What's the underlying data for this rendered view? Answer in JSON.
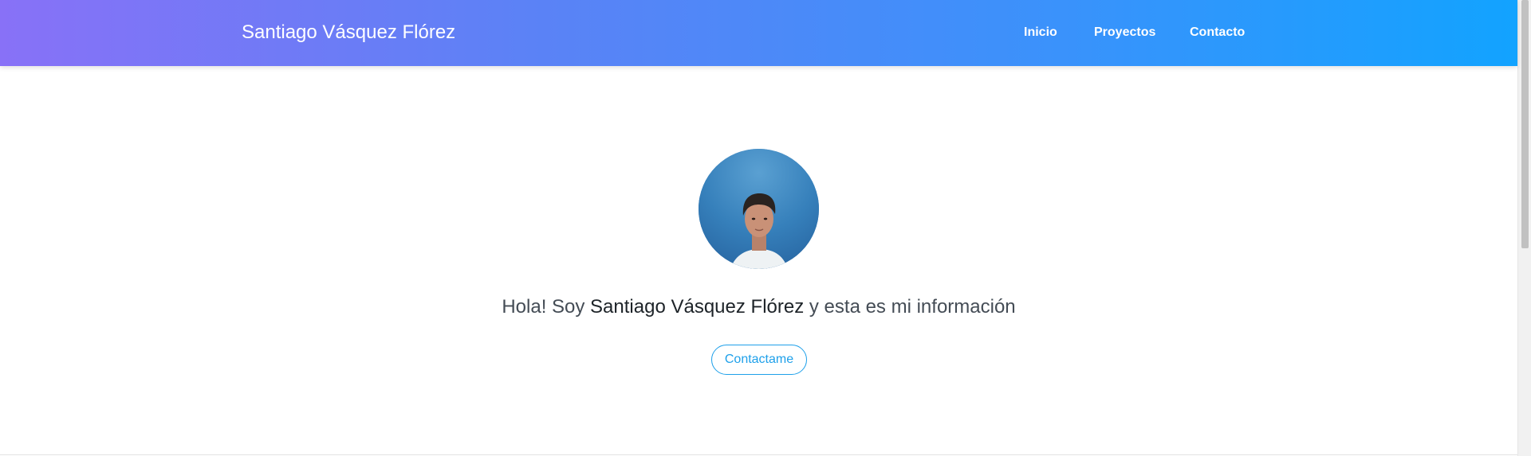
{
  "header": {
    "brand": "Santiago Vásquez Flórez",
    "nav": {
      "inicio": "Inicio",
      "proyectos": "Proyectos",
      "contacto": "Contacto"
    }
  },
  "hero": {
    "greeting_prefix": "Hola! Soy ",
    "greeting_name": "Santiago Vásquez Flórez",
    "greeting_suffix": " y esta es mi información",
    "contact_button": "Contactame"
  },
  "colors": {
    "header_gradient_start": "#8871f7",
    "header_gradient_end": "#12a3ff",
    "accent": "#1ea0ea"
  }
}
